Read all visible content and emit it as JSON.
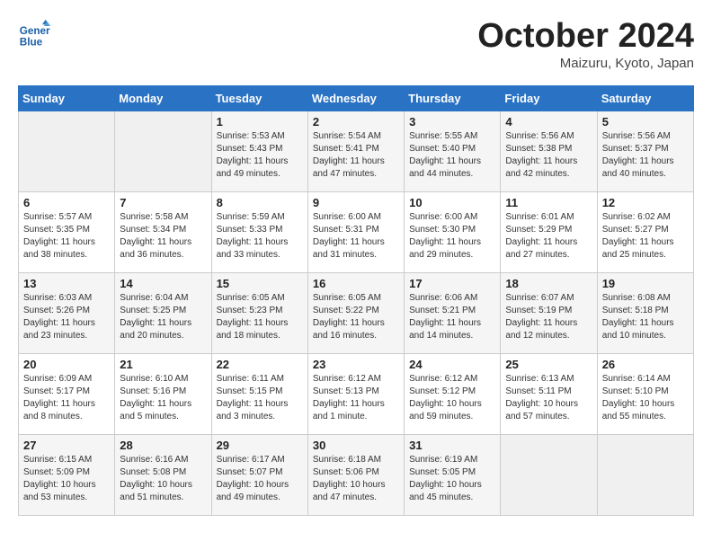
{
  "header": {
    "logo_line1": "General",
    "logo_line2": "Blue",
    "title": "October 2024",
    "location": "Maizuru, Kyoto, Japan"
  },
  "weekdays": [
    "Sunday",
    "Monday",
    "Tuesday",
    "Wednesday",
    "Thursday",
    "Friday",
    "Saturday"
  ],
  "weeks": [
    [
      {
        "day": "",
        "info": ""
      },
      {
        "day": "",
        "info": ""
      },
      {
        "day": "1",
        "info": "Sunrise: 5:53 AM\nSunset: 5:43 PM\nDaylight: 11 hours and 49 minutes."
      },
      {
        "day": "2",
        "info": "Sunrise: 5:54 AM\nSunset: 5:41 PM\nDaylight: 11 hours and 47 minutes."
      },
      {
        "day": "3",
        "info": "Sunrise: 5:55 AM\nSunset: 5:40 PM\nDaylight: 11 hours and 44 minutes."
      },
      {
        "day": "4",
        "info": "Sunrise: 5:56 AM\nSunset: 5:38 PM\nDaylight: 11 hours and 42 minutes."
      },
      {
        "day": "5",
        "info": "Sunrise: 5:56 AM\nSunset: 5:37 PM\nDaylight: 11 hours and 40 minutes."
      }
    ],
    [
      {
        "day": "6",
        "info": "Sunrise: 5:57 AM\nSunset: 5:35 PM\nDaylight: 11 hours and 38 minutes."
      },
      {
        "day": "7",
        "info": "Sunrise: 5:58 AM\nSunset: 5:34 PM\nDaylight: 11 hours and 36 minutes."
      },
      {
        "day": "8",
        "info": "Sunrise: 5:59 AM\nSunset: 5:33 PM\nDaylight: 11 hours and 33 minutes."
      },
      {
        "day": "9",
        "info": "Sunrise: 6:00 AM\nSunset: 5:31 PM\nDaylight: 11 hours and 31 minutes."
      },
      {
        "day": "10",
        "info": "Sunrise: 6:00 AM\nSunset: 5:30 PM\nDaylight: 11 hours and 29 minutes."
      },
      {
        "day": "11",
        "info": "Sunrise: 6:01 AM\nSunset: 5:29 PM\nDaylight: 11 hours and 27 minutes."
      },
      {
        "day": "12",
        "info": "Sunrise: 6:02 AM\nSunset: 5:27 PM\nDaylight: 11 hours and 25 minutes."
      }
    ],
    [
      {
        "day": "13",
        "info": "Sunrise: 6:03 AM\nSunset: 5:26 PM\nDaylight: 11 hours and 23 minutes."
      },
      {
        "day": "14",
        "info": "Sunrise: 6:04 AM\nSunset: 5:25 PM\nDaylight: 11 hours and 20 minutes."
      },
      {
        "day": "15",
        "info": "Sunrise: 6:05 AM\nSunset: 5:23 PM\nDaylight: 11 hours and 18 minutes."
      },
      {
        "day": "16",
        "info": "Sunrise: 6:05 AM\nSunset: 5:22 PM\nDaylight: 11 hours and 16 minutes."
      },
      {
        "day": "17",
        "info": "Sunrise: 6:06 AM\nSunset: 5:21 PM\nDaylight: 11 hours and 14 minutes."
      },
      {
        "day": "18",
        "info": "Sunrise: 6:07 AM\nSunset: 5:19 PM\nDaylight: 11 hours and 12 minutes."
      },
      {
        "day": "19",
        "info": "Sunrise: 6:08 AM\nSunset: 5:18 PM\nDaylight: 11 hours and 10 minutes."
      }
    ],
    [
      {
        "day": "20",
        "info": "Sunrise: 6:09 AM\nSunset: 5:17 PM\nDaylight: 11 hours and 8 minutes."
      },
      {
        "day": "21",
        "info": "Sunrise: 6:10 AM\nSunset: 5:16 PM\nDaylight: 11 hours and 5 minutes."
      },
      {
        "day": "22",
        "info": "Sunrise: 6:11 AM\nSunset: 5:15 PM\nDaylight: 11 hours and 3 minutes."
      },
      {
        "day": "23",
        "info": "Sunrise: 6:12 AM\nSunset: 5:13 PM\nDaylight: 11 hours and 1 minute."
      },
      {
        "day": "24",
        "info": "Sunrise: 6:12 AM\nSunset: 5:12 PM\nDaylight: 10 hours and 59 minutes."
      },
      {
        "day": "25",
        "info": "Sunrise: 6:13 AM\nSunset: 5:11 PM\nDaylight: 10 hours and 57 minutes."
      },
      {
        "day": "26",
        "info": "Sunrise: 6:14 AM\nSunset: 5:10 PM\nDaylight: 10 hours and 55 minutes."
      }
    ],
    [
      {
        "day": "27",
        "info": "Sunrise: 6:15 AM\nSunset: 5:09 PM\nDaylight: 10 hours and 53 minutes."
      },
      {
        "day": "28",
        "info": "Sunrise: 6:16 AM\nSunset: 5:08 PM\nDaylight: 10 hours and 51 minutes."
      },
      {
        "day": "29",
        "info": "Sunrise: 6:17 AM\nSunset: 5:07 PM\nDaylight: 10 hours and 49 minutes."
      },
      {
        "day": "30",
        "info": "Sunrise: 6:18 AM\nSunset: 5:06 PM\nDaylight: 10 hours and 47 minutes."
      },
      {
        "day": "31",
        "info": "Sunrise: 6:19 AM\nSunset: 5:05 PM\nDaylight: 10 hours and 45 minutes."
      },
      {
        "day": "",
        "info": ""
      },
      {
        "day": "",
        "info": ""
      }
    ]
  ]
}
